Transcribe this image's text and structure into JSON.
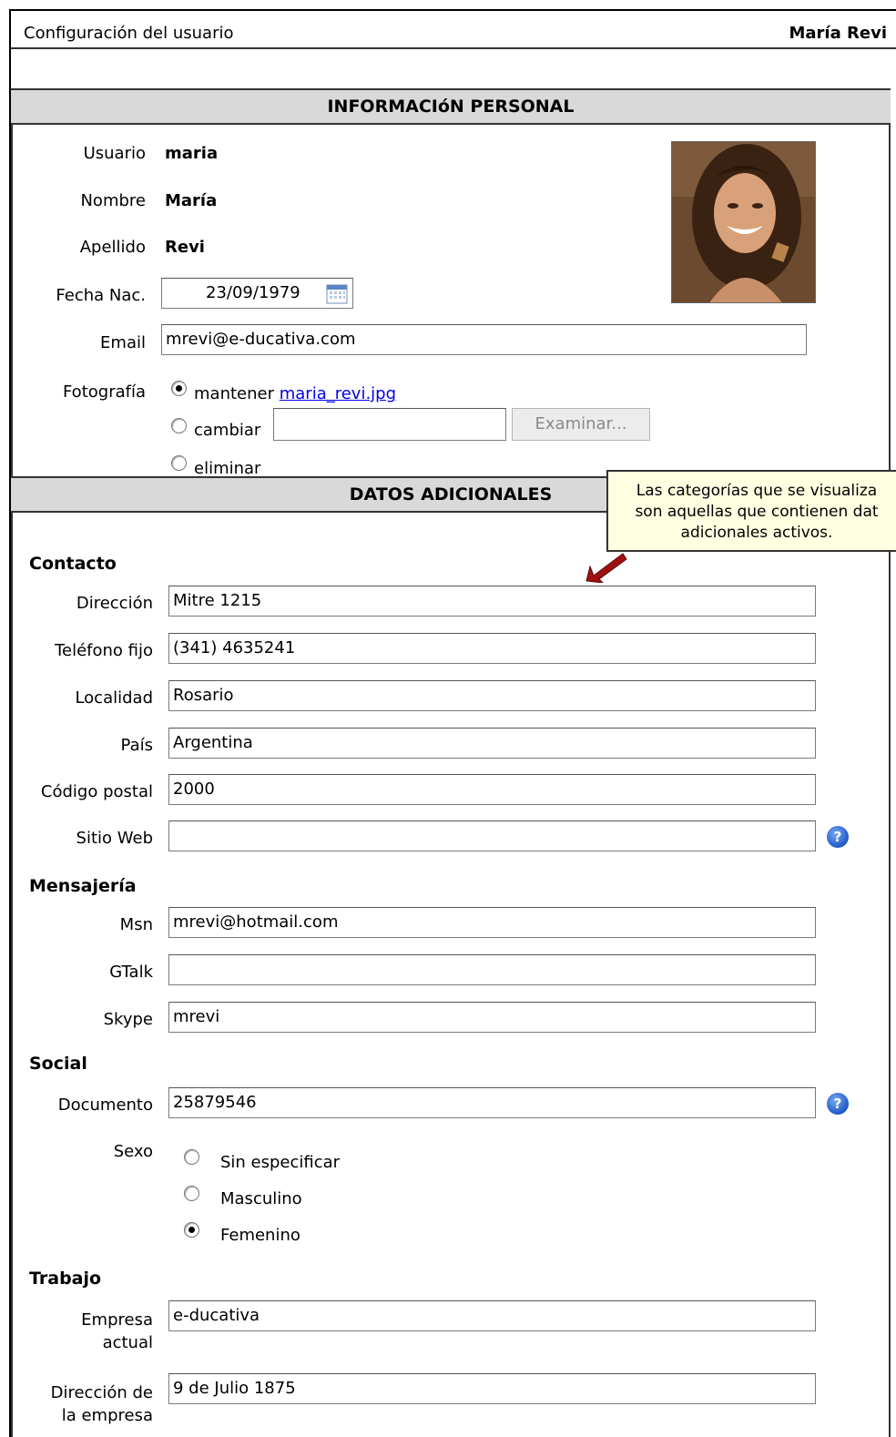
{
  "header": {
    "title": "Configuración del usuario",
    "user": "María Revi"
  },
  "personal": {
    "heading": "INFORMACIóN PERSONAL",
    "usuario_label": "Usuario",
    "usuario_value": "maria",
    "nombre_label": "Nombre",
    "nombre_value": "María",
    "apellido_label": "Apellido",
    "apellido_value": "Revi",
    "fecha_label": "Fecha Nac.",
    "fecha_value": "23/09/1979",
    "email_label": "Email",
    "email_value": "mrevi@e-ducativa.com",
    "foto_label": "Fotografía",
    "opt_mantener": "mantener",
    "foto_file": "maria_revi.jpg",
    "opt_cambiar": "cambiar",
    "cambiar_value": "",
    "browse_label": "Examinar...",
    "opt_eliminar": "eliminar"
  },
  "adicionales": {
    "heading": "DATOS ADICIONALES",
    "tooltip_lines": [
      "Las categorías  que se visualiza",
      "son aquellas que contienen dat",
      "adicionales activos."
    ],
    "contacto": {
      "title": "Contacto",
      "direccion_label": "Dirección",
      "direccion_value": "Mitre 1215",
      "telefono_label": "Teléfono fijo",
      "telefono_value": "(341) 4635241",
      "localidad_label": "Localidad",
      "localidad_value": "Rosario",
      "pais_label": "País",
      "pais_value": "Argentina",
      "cp_label": "Código postal",
      "cp_value": "2000",
      "web_label": "Sitio Web",
      "web_value": ""
    },
    "mensajeria": {
      "title": "Mensajería",
      "msn_label": "Msn",
      "msn_value": "mrevi@hotmail.com",
      "gtalk_label": "GTalk",
      "gtalk_value": "",
      "skype_label": "Skype",
      "skype_value": "mrevi"
    },
    "social": {
      "title": "Social",
      "documento_label": "Documento",
      "documento_value": "25879546",
      "sexo_label": "Sexo",
      "sexo_options": [
        "Sin especificar",
        "Masculino",
        "Femenino"
      ],
      "sexo_selected": "Femenino"
    },
    "trabajo": {
      "title": "Trabajo",
      "empresa_label_1": "Empresa",
      "empresa_label_2": "actual",
      "empresa_value": "e-ducativa",
      "dir_empresa_label_1": "Dirección de",
      "dir_empresa_label_2": "la empresa",
      "dir_empresa_value": "9 de Julio 1875"
    }
  },
  "icons": {
    "calendar": "calendar-icon",
    "help": "help-icon",
    "photo": "profile-photo"
  },
  "colors": {
    "section_header_bg": "#d9d9d9",
    "tooltip_bg": "#ffffe1",
    "help_blue": "#1f59c7",
    "arrow_red": "#a01010"
  }
}
